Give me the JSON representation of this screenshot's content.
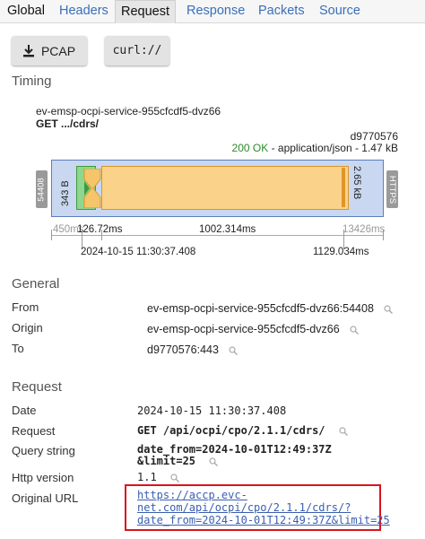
{
  "tabs": [
    "Global",
    "Headers",
    "Request",
    "Response",
    "Packets",
    "Source"
  ],
  "buttons": {
    "pcap": "PCAP",
    "curl": "curl://"
  },
  "timing": {
    "title": "Timing",
    "source": "ev-emsp-ocpi-service-955cfcdf5-dvz66",
    "request_line": "GET .../cdrs/",
    "destination": "d9770576",
    "status": "200 OK",
    "content_info": " - application/json - 1.47 kB",
    "left_port": "54408",
    "right_proto": "HTTPS",
    "sent_size": "343 B",
    "received_size": "2.65 kB",
    "axis": {
      "left_grey": "450ms",
      "t1": "126.72ms",
      "middle": "1002.314ms",
      "right_grey": "13426ms",
      "start_time": "2024-10-15 11:30:37.408",
      "end": "1129.034ms"
    }
  },
  "general": {
    "title": "General",
    "rows": [
      {
        "key": "From",
        "value": "ev-emsp-ocpi-service-955cfcdf5-dvz66:54408"
      },
      {
        "key": "Origin",
        "value": "ev-emsp-ocpi-service-955cfcdf5-dvz66"
      },
      {
        "key": "To",
        "value": "d9770576:443"
      }
    ]
  },
  "request": {
    "title": "Request",
    "date_key": "Date",
    "date": "2024-10-15 11:30:37.408",
    "request_key": "Request",
    "request_value": "GET /api/ocpi/cpo/2.1.1/cdrs/",
    "query_key": "Query string",
    "query_line1": "date_from=2024-10-01T12:49:37Z",
    "query_line2": "&limit=25",
    "http_key": "Http version",
    "http_value": "1.1",
    "url_key": "Original URL",
    "url_line1": "https://accp.evc-",
    "url_line2": "net.com/api/ocpi/cpo/2.1.1/cdrs/?",
    "url_line3": "date_from=2024-10-01T12:49:37Z&limit=25"
  },
  "colors": {
    "accent_tab": "#3a6fb8",
    "status_ok": "#2a8a2a",
    "highlight": "#d9141c"
  },
  "icons": {
    "download": "download-icon",
    "search": "magnifier-icon"
  }
}
